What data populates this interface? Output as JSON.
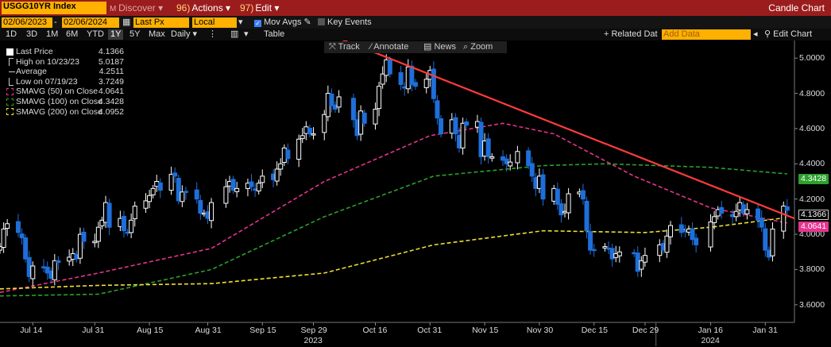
{
  "topbar": {
    "ticker": "USGG10YR Index",
    "discover_label": "Discover",
    "actions_num": "96)",
    "actions_label": "Actions",
    "edit_num": "97)",
    "edit_label": "Edit",
    "chart_type": "Candle Chart"
  },
  "controls": {
    "start_date": "02/06/2023",
    "end_date": "02/06/2024",
    "price_field": "Last Px",
    "currency": "Local CCY",
    "mov_avgs_label": "Mov Avgs",
    "key_events_label": "Key Events",
    "ranges": [
      "1D",
      "3D",
      "1M",
      "6M",
      "YTD",
      "1Y",
      "5Y",
      "Max"
    ],
    "selected_range": "1Y",
    "period": "Daily",
    "table_label": "Table",
    "related_label": "+ Related Dat",
    "add_data_placeholder": "Add Data",
    "edit_chart_label": "Edit Chart"
  },
  "tools": {
    "track": "Track",
    "annotate": "Annotate",
    "news": "News",
    "zoom": "Zoom"
  },
  "legend": [
    {
      "label": "Last Price",
      "value": "4.1366",
      "icon": "white-square",
      "color": "#ffffff"
    },
    {
      "label": "High on 10/23/23",
      "value": "5.0187",
      "icon": "high-marker",
      "color": "#dddddd"
    },
    {
      "label": "Average",
      "value": "4.2511",
      "icon": "average-marker",
      "color": "#dddddd"
    },
    {
      "label": "Low on 07/19/23",
      "value": "3.7249",
      "icon": "low-marker",
      "color": "#dddddd"
    },
    {
      "label": "SMAVG (50)  on Close",
      "value": "4.0641",
      "icon": "dashed-square",
      "color": "#e6338f"
    },
    {
      "label": "SMAVG (100)  on Close",
      "value": "4.3428",
      "icon": "dashed-square",
      "color": "#2ca02c"
    },
    {
      "label": "SMAVG (200)  on Close",
      "value": "4.0952",
      "icon": "dashed-square",
      "color": "#f0e130"
    }
  ],
  "badges": {
    "sma100": "4.3428",
    "last": "4.1366",
    "sma50": "4.0641"
  },
  "chart_data": {
    "type": "candlestick",
    "ylim": [
      3.5,
      5.1
    ],
    "y_ticks": [
      "5.0000",
      "4.8000",
      "4.6000",
      "4.4000",
      "4.2000",
      "4.0000",
      "3.8000",
      "3.6000"
    ],
    "y_tick_values": [
      5.0,
      4.8,
      4.6,
      4.4,
      4.2,
      4.0,
      3.8,
      3.6
    ],
    "x_tick_labels": [
      "Jul 14",
      "Jul 31",
      "Aug 15",
      "Aug 31",
      "Sep 15",
      "Sep 29",
      "Oct 16",
      "Oct 31",
      "Nov 15",
      "Nov 30",
      "Dec 15",
      "Dec 29",
      "Jan 16",
      "Jan 31"
    ],
    "x_tick_dates": [
      "2023-07-14",
      "2023-07-31",
      "2023-08-15",
      "2023-08-31",
      "2023-09-15",
      "2023-09-29",
      "2023-10-16",
      "2023-10-31",
      "2023-11-15",
      "2023-11-30",
      "2023-12-15",
      "2023-12-29",
      "2024-01-16",
      "2024-01-31"
    ],
    "x_years": [
      {
        "label": "2023",
        "date": "2023-09-29"
      },
      {
        "label": "2024",
        "date": "2024-01-16"
      }
    ],
    "x_range": [
      "2023-07-05",
      "2024-02-08"
    ],
    "candle_colors": {
      "up": "#ffffff",
      "down": "#1e6fd9"
    },
    "closes": [
      [
        "2023-07-05",
        3.93
      ],
      [
        "2023-07-06",
        4.03
      ],
      [
        "2023-07-07",
        4.06
      ],
      [
        "2023-07-10",
        4.01
      ],
      [
        "2023-07-11",
        3.98
      ],
      [
        "2023-07-12",
        3.86
      ],
      [
        "2023-07-13",
        3.76
      ],
      [
        "2023-07-14",
        3.82
      ],
      [
        "2023-07-17",
        3.81
      ],
      [
        "2023-07-18",
        3.78
      ],
      [
        "2023-07-19",
        3.75
      ],
      [
        "2023-07-20",
        3.85
      ],
      [
        "2023-07-21",
        3.84
      ],
      [
        "2023-07-24",
        3.87
      ],
      [
        "2023-07-25",
        3.89
      ],
      [
        "2023-07-26",
        3.86
      ],
      [
        "2023-07-27",
        4.0
      ],
      [
        "2023-07-28",
        3.96
      ],
      [
        "2023-07-31",
        3.96
      ],
      [
        "2023-08-01",
        4.04
      ],
      [
        "2023-08-02",
        4.08
      ],
      [
        "2023-08-03",
        4.18
      ],
      [
        "2023-08-04",
        4.04
      ],
      [
        "2023-08-07",
        4.09
      ],
      [
        "2023-08-08",
        4.02
      ],
      [
        "2023-08-09",
        4.01
      ],
      [
        "2023-08-10",
        4.08
      ],
      [
        "2023-08-11",
        4.16
      ],
      [
        "2023-08-14",
        4.19
      ],
      [
        "2023-08-15",
        4.22
      ],
      [
        "2023-08-16",
        4.26
      ],
      [
        "2023-08-17",
        4.3
      ],
      [
        "2023-08-18",
        4.25
      ],
      [
        "2023-08-21",
        4.34
      ],
      [
        "2023-08-22",
        4.33
      ],
      [
        "2023-08-23",
        4.19
      ],
      [
        "2023-08-24",
        4.24
      ],
      [
        "2023-08-25",
        4.24
      ],
      [
        "2023-08-28",
        4.2
      ],
      [
        "2023-08-29",
        4.12
      ],
      [
        "2023-08-30",
        4.12
      ],
      [
        "2023-08-31",
        4.09
      ],
      [
        "2023-09-01",
        4.18
      ],
      [
        "2023-09-05",
        4.27
      ],
      [
        "2023-09-06",
        4.3
      ],
      [
        "2023-09-07",
        4.25
      ],
      [
        "2023-09-08",
        4.26
      ],
      [
        "2023-09-11",
        4.29
      ],
      [
        "2023-09-12",
        4.27
      ],
      [
        "2023-09-13",
        4.25
      ],
      [
        "2023-09-14",
        4.29
      ],
      [
        "2023-09-15",
        4.33
      ],
      [
        "2023-09-18",
        4.31
      ],
      [
        "2023-09-19",
        4.37
      ],
      [
        "2023-09-20",
        4.4
      ],
      [
        "2023-09-21",
        4.49
      ],
      [
        "2023-09-22",
        4.43
      ],
      [
        "2023-09-25",
        4.54
      ],
      [
        "2023-09-26",
        4.56
      ],
      [
        "2023-09-27",
        4.61
      ],
      [
        "2023-09-28",
        4.57
      ],
      [
        "2023-09-29",
        4.57
      ],
      [
        "2023-10-02",
        4.68
      ],
      [
        "2023-10-03",
        4.8
      ],
      [
        "2023-10-04",
        4.73
      ],
      [
        "2023-10-05",
        4.71
      ],
      [
        "2023-10-06",
        4.78
      ],
      [
        "2023-10-10",
        4.65
      ],
      [
        "2023-10-11",
        4.56
      ],
      [
        "2023-10-12",
        4.7
      ],
      [
        "2023-10-13",
        4.63
      ],
      [
        "2023-10-16",
        4.71
      ],
      [
        "2023-10-17",
        4.84
      ],
      [
        "2023-10-18",
        4.91
      ],
      [
        "2023-10-19",
        4.99
      ],
      [
        "2023-10-20",
        4.91
      ],
      [
        "2023-10-23",
        4.85
      ],
      [
        "2023-10-24",
        4.83
      ],
      [
        "2023-10-25",
        4.95
      ],
      [
        "2023-10-26",
        4.85
      ],
      [
        "2023-10-27",
        4.84
      ],
      [
        "2023-10-30",
        4.88
      ],
      [
        "2023-10-31",
        4.93
      ],
      [
        "2023-11-01",
        4.77
      ],
      [
        "2023-11-02",
        4.66
      ],
      [
        "2023-11-03",
        4.57
      ],
      [
        "2023-11-06",
        4.65
      ],
      [
        "2023-11-07",
        4.57
      ],
      [
        "2023-11-08",
        4.49
      ],
      [
        "2023-11-09",
        4.63
      ],
      [
        "2023-11-10",
        4.62
      ],
      [
        "2023-11-13",
        4.64
      ],
      [
        "2023-11-14",
        4.44
      ],
      [
        "2023-11-15",
        4.53
      ],
      [
        "2023-11-16",
        4.44
      ],
      [
        "2023-11-17",
        4.44
      ],
      [
        "2023-11-20",
        4.42
      ],
      [
        "2023-11-21",
        4.4
      ],
      [
        "2023-11-22",
        4.41
      ],
      [
        "2023-11-24",
        4.47
      ],
      [
        "2023-11-27",
        4.39
      ],
      [
        "2023-11-28",
        4.33
      ],
      [
        "2023-11-29",
        4.26
      ],
      [
        "2023-11-30",
        4.33
      ],
      [
        "2023-12-01",
        4.2
      ],
      [
        "2023-12-04",
        4.26
      ],
      [
        "2023-12-05",
        4.17
      ],
      [
        "2023-12-06",
        4.11
      ],
      [
        "2023-12-07",
        4.13
      ],
      [
        "2023-12-08",
        4.23
      ],
      [
        "2023-12-11",
        4.24
      ],
      [
        "2023-12-12",
        4.2
      ],
      [
        "2023-12-13",
        4.02
      ],
      [
        "2023-12-14",
        3.91
      ],
      [
        "2023-12-15",
        3.91
      ],
      [
        "2023-12-18",
        3.93
      ],
      [
        "2023-12-19",
        3.92
      ],
      [
        "2023-12-20",
        3.86
      ],
      [
        "2023-12-21",
        3.89
      ],
      [
        "2023-12-22",
        3.9
      ],
      [
        "2023-12-26",
        3.89
      ],
      [
        "2023-12-27",
        3.79
      ],
      [
        "2023-12-28",
        3.85
      ],
      [
        "2023-12-29",
        3.88
      ],
      [
        "2024-01-02",
        3.94
      ],
      [
        "2024-01-03",
        3.91
      ],
      [
        "2024-01-04",
        3.99
      ],
      [
        "2024-01-05",
        4.05
      ],
      [
        "2024-01-08",
        4.01
      ],
      [
        "2024-01-09",
        4.02
      ],
      [
        "2024-01-10",
        4.03
      ],
      [
        "2024-01-11",
        3.97
      ],
      [
        "2024-01-12",
        3.94
      ],
      [
        "2024-01-16",
        4.07
      ],
      [
        "2024-01-17",
        4.1
      ],
      [
        "2024-01-18",
        4.14
      ],
      [
        "2024-01-19",
        4.12
      ],
      [
        "2024-01-22",
        4.1
      ],
      [
        "2024-01-23",
        4.13
      ],
      [
        "2024-01-24",
        4.18
      ],
      [
        "2024-01-25",
        4.12
      ],
      [
        "2024-01-26",
        4.14
      ],
      [
        "2024-01-29",
        4.08
      ],
      [
        "2024-01-30",
        4.04
      ],
      [
        "2024-01-31",
        3.91
      ],
      [
        "2024-02-01",
        3.87
      ],
      [
        "2024-02-02",
        4.03
      ],
      [
        "2024-02-05",
        4.16
      ],
      [
        "2024-02-06",
        4.1366
      ]
    ],
    "series": [
      {
        "name": "SMAVG (50)  on Close",
        "color": "#e6338f",
        "style": "dashed",
        "points": [
          [
            "2023-07-05",
            3.67
          ],
          [
            "2023-08-01",
            3.78
          ],
          [
            "2023-09-01",
            3.92
          ],
          [
            "2023-10-02",
            4.3
          ],
          [
            "2023-10-31",
            4.56
          ],
          [
            "2023-11-20",
            4.63
          ],
          [
            "2023-12-04",
            4.57
          ],
          [
            "2023-12-26",
            4.33
          ],
          [
            "2024-01-16",
            4.15
          ],
          [
            "2024-02-06",
            4.0641
          ]
        ]
      },
      {
        "name": "SMAVG (100)  on Close",
        "color": "#2ca02c",
        "style": "dashed",
        "points": [
          [
            "2023-07-05",
            3.65
          ],
          [
            "2023-08-01",
            3.66
          ],
          [
            "2023-09-01",
            3.8
          ],
          [
            "2023-10-02",
            4.1
          ],
          [
            "2023-11-01",
            4.33
          ],
          [
            "2023-12-01",
            4.39
          ],
          [
            "2023-12-18",
            4.4
          ],
          [
            "2024-01-16",
            4.38
          ],
          [
            "2024-02-06",
            4.3428
          ]
        ]
      },
      {
        "name": "SMAVG (200)  on Close",
        "color": "#f0e130",
        "style": "dashed",
        "points": [
          [
            "2023-07-05",
            3.69
          ],
          [
            "2023-08-01",
            3.71
          ],
          [
            "2023-09-01",
            3.72
          ],
          [
            "2023-10-02",
            3.78
          ],
          [
            "2023-11-01",
            3.94
          ],
          [
            "2023-12-01",
            4.02
          ],
          [
            "2023-12-29",
            4.01
          ],
          [
            "2024-01-16",
            4.04
          ],
          [
            "2024-02-06",
            4.0952
          ]
        ]
      }
    ],
    "trendline": {
      "color": "#ff3b3b",
      "from": [
        "2023-10-05",
        5.12
      ],
      "to": [
        "2024-02-08",
        4.09
      ]
    }
  }
}
